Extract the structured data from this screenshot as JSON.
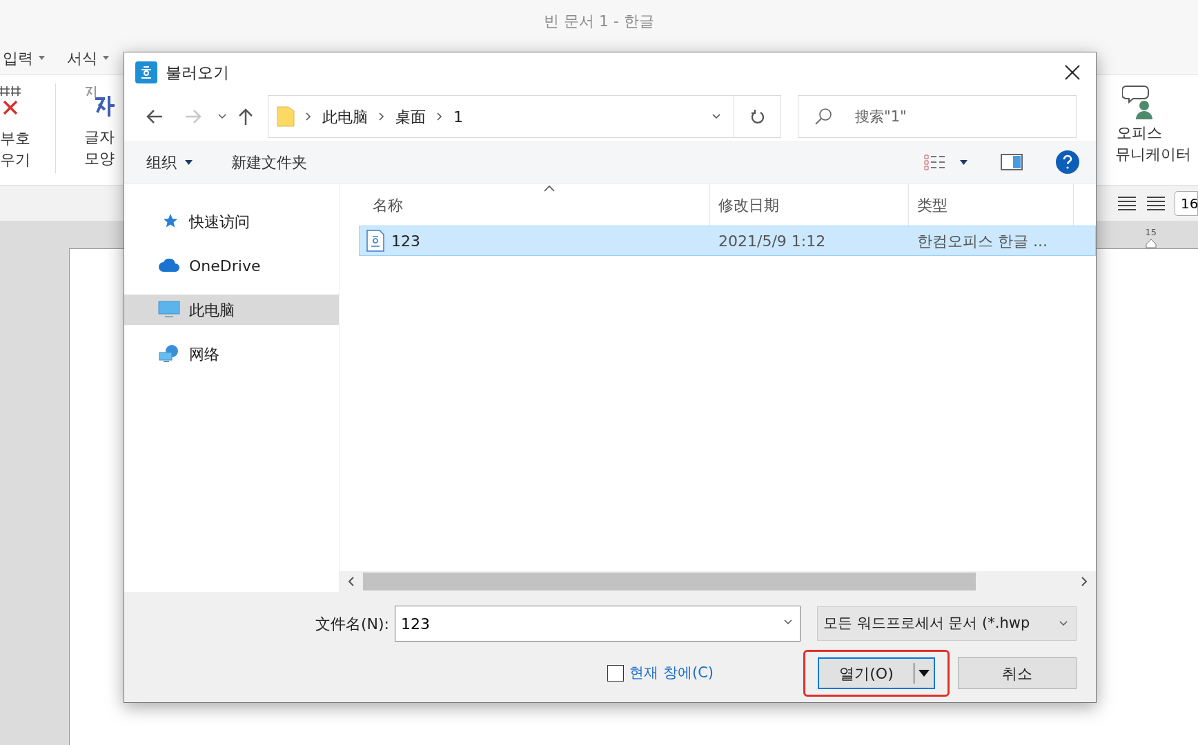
{
  "app": {
    "title": "빈 문서 1 - 한글",
    "menu": [
      "입력",
      "서식"
    ],
    "ribbon_left": [
      {
        "line1": "부호",
        "line2": "우기"
      },
      {
        "line1": "글자",
        "line2": "모양"
      }
    ],
    "ribbon_right": {
      "line1": "오피스",
      "line2": "뮤니케이터"
    },
    "size_field": "16",
    "ruler_mark": "15"
  },
  "dialog": {
    "title": "불러오기",
    "nav": {
      "back_disabled": false,
      "forward_disabled": true
    },
    "path": [
      "此电脑",
      "桌面",
      "1"
    ],
    "search": {
      "placeholder": "搜索\"1\""
    },
    "toolbar": {
      "organize": "组织",
      "new_folder": "新建文件夹"
    },
    "sidebar": [
      {
        "label": "快速访问",
        "kind": "star",
        "selected": false
      },
      {
        "label": "OneDrive",
        "kind": "cloud",
        "selected": false
      },
      {
        "label": "此电脑",
        "kind": "pc",
        "selected": true
      },
      {
        "label": "网络",
        "kind": "network",
        "selected": false
      }
    ],
    "columns": [
      "名称",
      "修改日期",
      "类型"
    ],
    "rows": [
      {
        "name": "123",
        "date": "2021/5/9 1:12",
        "type": "한컴오피스 한글 ...",
        "selected": true
      }
    ],
    "filename_label": "文件名(N):",
    "filename": "123",
    "filetype": "모든 워드프로세서 문서 (*.hwp",
    "current_window": {
      "label": "현재 창에(C)",
      "checked": false
    },
    "open_button": "열기(O)",
    "cancel_button": "취소"
  }
}
